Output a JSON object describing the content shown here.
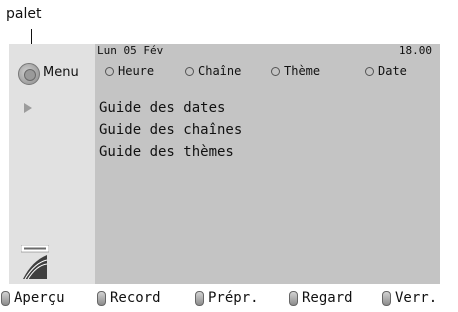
{
  "annotation": {
    "label": "palet"
  },
  "sidebar": {
    "menu_label": "Menu"
  },
  "header": {
    "date": "Lun 05 Fév",
    "time": "18.00",
    "tabs": [
      {
        "label": "Heure"
      },
      {
        "label": "Chaîne"
      },
      {
        "label": "Thème"
      },
      {
        "label": "Date"
      }
    ]
  },
  "guide": {
    "items": [
      {
        "label": "Guide des dates"
      },
      {
        "label": "Guide des chaînes"
      },
      {
        "label": "Guide des thèmes"
      }
    ]
  },
  "footer": {
    "buttons": [
      {
        "label": "Aperçu"
      },
      {
        "label": "Record"
      },
      {
        "label": "Prépr."
      },
      {
        "label": "Regard"
      },
      {
        "label": "Verr."
      }
    ]
  },
  "icons": {
    "menu": "menu-button-icon",
    "selection": "right-arrow-icon",
    "logo": "nextview-logo-icon",
    "footer_button": "pill-button-icon"
  }
}
